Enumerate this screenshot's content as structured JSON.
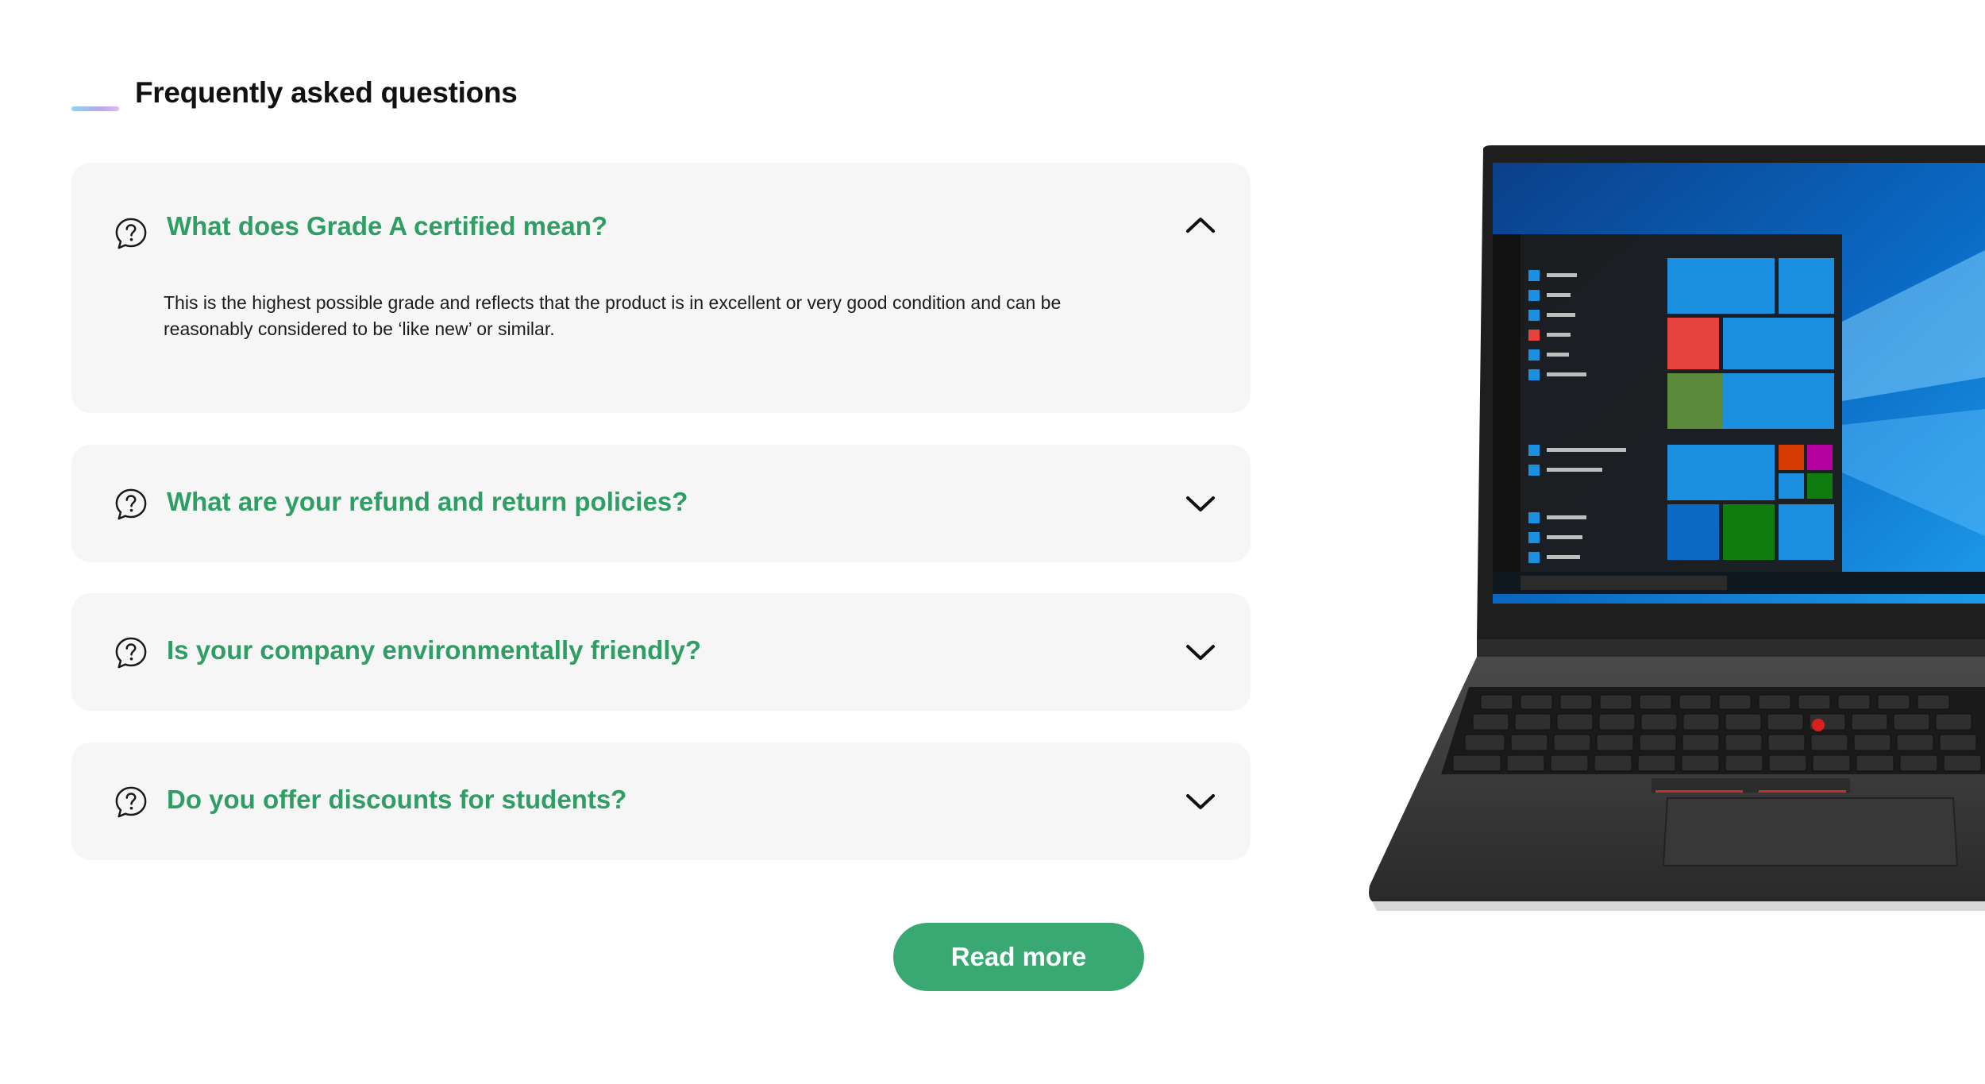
{
  "faq": {
    "title": "Frequently asked questions",
    "items": [
      {
        "question": "What does Grade A certified mean?",
        "expanded": true,
        "answer_line1": "This is the highest possible grade and reflects that the product is in excellent or very good condition and can be",
        "answer_line2": "reasonably considered to be ‘like new’ or similar."
      },
      {
        "question": "What are your refund and return policies?",
        "expanded": false
      },
      {
        "question": "Is your company environmentally friendly?",
        "expanded": false
      },
      {
        "question": "Do you offer discounts for students?",
        "expanded": false
      }
    ],
    "read_more_label": "Read more"
  },
  "icons": {
    "question": "question-bubble-icon",
    "expanded": "chevron-up-icon",
    "collapsed": "chevron-down-icon"
  },
  "colors": {
    "accent_green": "#2f9e64",
    "button_green": "#3aa872",
    "card_bg": "#f6f6f6"
  }
}
